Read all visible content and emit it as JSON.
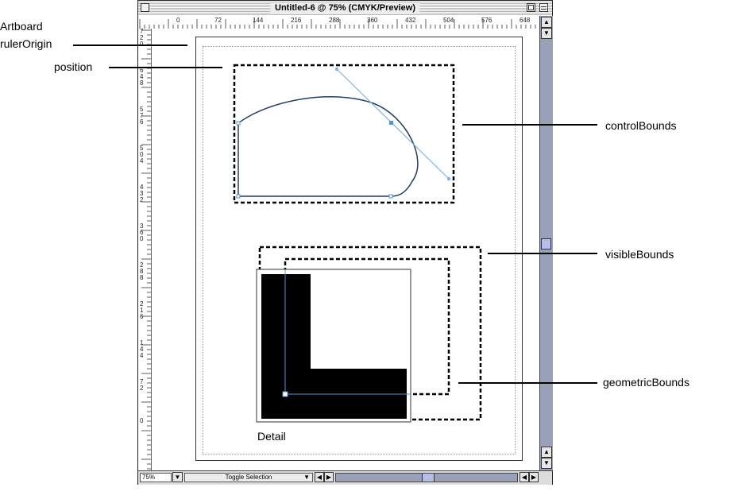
{
  "window": {
    "title": "Untitled-6 @ 75% (CMYK/Preview)",
    "zoom": "75%",
    "status": "Toggle Selection"
  },
  "ruler": {
    "top_labels": [
      "0",
      "72",
      "144",
      "216",
      "288",
      "360",
      "432",
      "504",
      "576",
      "648"
    ],
    "left_labels": [
      "7\n2\n0",
      "6\n4\n8",
      "5\n7\n6",
      "5\n0\n4",
      "4\n3\n2",
      "3\n6\n0",
      "2\n8\n8",
      "2\n1\n6",
      "1\n4\n4",
      "7\n2",
      "0"
    ]
  },
  "annotations": {
    "artboard": "Artboard",
    "ruler_origin": "rulerOrigin",
    "position": "position",
    "control_bounds": "controlBounds",
    "visible_bounds": "visibleBounds",
    "geometric_bounds": "geometricBounds",
    "detail": "Detail"
  },
  "colors": {
    "path": "#1f3f66",
    "handle": "#7fb3e0",
    "selection": "#5a8fd0",
    "shape_fill": "#000000"
  },
  "icons": {
    "close": "close-box-icon",
    "zoom": "zoom-box-icon",
    "collapse": "collapse-box-icon"
  }
}
